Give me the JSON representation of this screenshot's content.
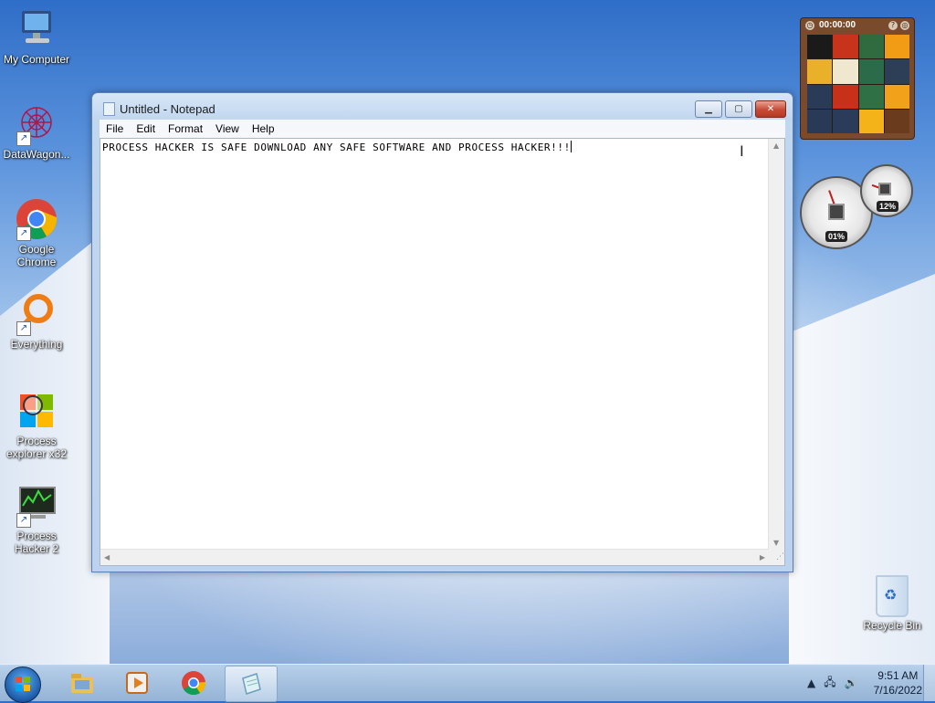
{
  "desktop": {
    "icons": [
      {
        "label": "My Computer",
        "icon": "computer-icon"
      },
      {
        "label": "DataWagon...",
        "icon": "datawagon-icon"
      },
      {
        "label": "Google Chrome",
        "icon": "chrome-icon"
      },
      {
        "label": "Everything",
        "icon": "everything-icon"
      },
      {
        "label": "Process explorer x32",
        "icon": "process-explorer-icon"
      },
      {
        "label": "Process Hacker 2",
        "icon": "process-hacker-icon"
      }
    ],
    "recycle_bin": {
      "label": "Recycle Bin",
      "icon": "recycle-bin-icon"
    }
  },
  "notepad": {
    "title": "Untitled - Notepad",
    "menu": [
      "File",
      "Edit",
      "Format",
      "View",
      "Help"
    ],
    "content": "PROCESS HACKER IS SAFE DOWNLOAD ANY SAFE SOFTWARE AND PROCESS HACKER!!!",
    "controls": {
      "minimize": "▁",
      "maximize": "▢",
      "close": "✕"
    }
  },
  "gadgets": {
    "puzzle": {
      "timer": "00:00:00"
    },
    "cpu_meter": {
      "cpu": "01%",
      "ram": "12%"
    }
  },
  "taskbar": {
    "apps": [
      {
        "name": "explorer",
        "icon": "folder-icon"
      },
      {
        "name": "media player",
        "icon": "media-player-icon"
      },
      {
        "name": "chrome",
        "icon": "chrome-icon"
      },
      {
        "name": "notepad",
        "icon": "notepad-icon",
        "active": true
      }
    ],
    "clock": {
      "time": "9:51 AM",
      "date": "7/16/2022"
    }
  },
  "colors": {
    "accent": "#3a6fc4",
    "close": "#c74a34"
  }
}
